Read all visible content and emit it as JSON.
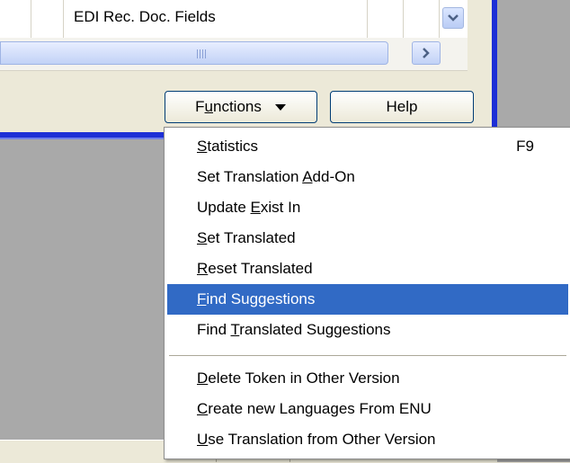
{
  "grid": {
    "cell_text": "EDI Rec. Doc. Fields"
  },
  "buttons": {
    "functions": {
      "pre": "F",
      "acc": "u",
      "post": "nctions"
    },
    "help": {
      "label": "Help"
    }
  },
  "menu": {
    "items": [
      {
        "pre": "",
        "acc": "S",
        "post": "tatistics",
        "accel": "F9",
        "selected": false
      },
      {
        "pre": "Set Translation ",
        "acc": "A",
        "post": "dd-On",
        "accel": "",
        "selected": false
      },
      {
        "pre": "Update ",
        "acc": "E",
        "post": "xist In",
        "accel": "",
        "selected": false
      },
      {
        "pre": "",
        "acc": "S",
        "post": "et Translated",
        "accel": "",
        "selected": false
      },
      {
        "pre": "",
        "acc": "R",
        "post": "eset Translated",
        "accel": "",
        "selected": false
      },
      {
        "pre": "",
        "acc": "F",
        "post": "ind Suggestions",
        "accel": "",
        "selected": true
      },
      {
        "pre": "Find ",
        "acc": "T",
        "post": "ranslated Suggestions",
        "accel": "",
        "selected": false
      },
      {
        "pre": "",
        "acc": "D",
        "post": "elete Token in Other Version",
        "accel": "",
        "selected": false
      },
      {
        "pre": "",
        "acc": "C",
        "post": "reate new Languages From ENU",
        "accel": "",
        "selected": false
      },
      {
        "pre": "",
        "acc": "U",
        "post": "se Translation from Other Version",
        "accel": "",
        "selected": false
      }
    ]
  },
  "colors": {
    "menu_highlight": "#316ac5",
    "frame_blue": "#1d2fd6",
    "window_bg": "#ece9d8"
  },
  "icons": {
    "combo": "chevron-down-icon",
    "scroll_right": "chevron-right-icon",
    "dropdown": "triangle-down-icon"
  }
}
